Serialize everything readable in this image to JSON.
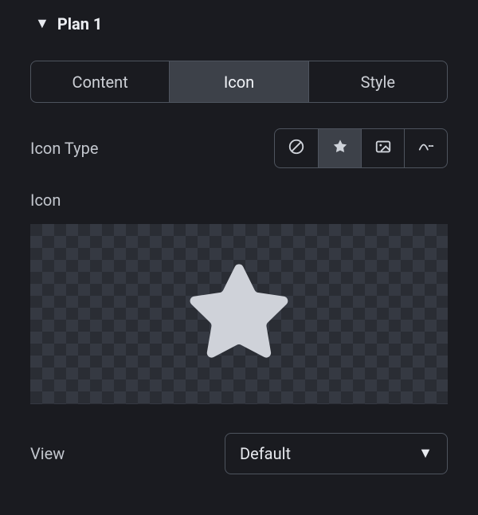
{
  "section": {
    "title": "Plan 1"
  },
  "tabs": {
    "content": "Content",
    "icon": "Icon",
    "style": "Style"
  },
  "labels": {
    "icon_type": "Icon Type",
    "icon": "Icon",
    "view": "View"
  },
  "icon_type": {
    "selected": "star",
    "options": [
      "none",
      "star",
      "image",
      "lottie"
    ]
  },
  "view": {
    "selected": "Default",
    "options": [
      "Default"
    ]
  }
}
